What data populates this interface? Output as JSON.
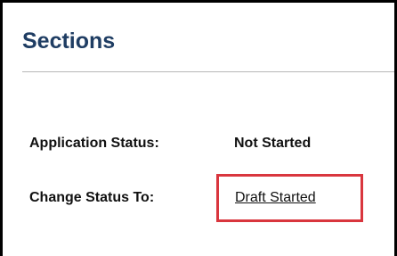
{
  "panel": {
    "title": "Sections"
  },
  "status": {
    "application_status_label": "Application Status:",
    "application_status_value": "Not Started",
    "change_status_label": "Change Status To:",
    "change_status_link": "Draft Started"
  },
  "colors": {
    "title": "#1f3d63",
    "highlight_border": "#d9363e",
    "divider": "#b8b8b8"
  }
}
